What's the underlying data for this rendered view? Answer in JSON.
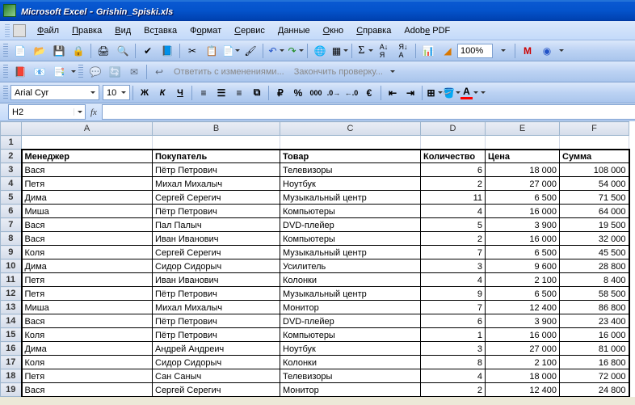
{
  "title_bar": {
    "app": "Microsoft Excel",
    "doc": "Grishin_Spiski.xls"
  },
  "menus": [
    "Файл",
    "Правка",
    "Вид",
    "Вставка",
    "Формат",
    "Сервис",
    "Данные",
    "Окно",
    "Справка",
    "Adobe PDF"
  ],
  "menus_ul": [
    0,
    0,
    0,
    2,
    1,
    0,
    0,
    0,
    0,
    4
  ],
  "toolbar1": {
    "zoom": "100%"
  },
  "review": {
    "reply": "Ответить с изменениями...",
    "end": "Закончить проверку..."
  },
  "format": {
    "font": "Arial Cyr",
    "size": "10",
    "bold": "Ж",
    "italic": "К",
    "underline": "Ч"
  },
  "namebox": "H2",
  "fx": "fx",
  "columns": [
    "A",
    "B",
    "C",
    "D",
    "E",
    "F"
  ],
  "col_widths": [
    "col-A",
    "col-B",
    "col-C",
    "col-D",
    "col-E",
    "col-F"
  ],
  "headers": [
    "Менеджер",
    "Покупатель",
    "Товар",
    "Количество",
    "Цена",
    "Сумма"
  ],
  "rows": [
    {
      "n": 3,
      "c": [
        "Вася",
        "Пётр Петрович",
        "Телевизоры",
        "6",
        "18 000",
        "108 000"
      ]
    },
    {
      "n": 4,
      "c": [
        "Петя",
        "Михал Михалыч",
        "Ноутбук",
        "2",
        "27 000",
        "54 000"
      ]
    },
    {
      "n": 5,
      "c": [
        "Дима",
        "Сергей Серегич",
        "Музыкальный центр",
        "11",
        "6 500",
        "71 500"
      ]
    },
    {
      "n": 6,
      "c": [
        "Миша",
        "Пётр Петрович",
        "Компьютеры",
        "4",
        "16 000",
        "64 000"
      ]
    },
    {
      "n": 7,
      "c": [
        "Вася",
        "Пал Палыч",
        "DVD-плейер",
        "5",
        "3 900",
        "19 500"
      ]
    },
    {
      "n": 8,
      "c": [
        "Вася",
        "Иван Иванович",
        "Компьютеры",
        "2",
        "16 000",
        "32 000"
      ]
    },
    {
      "n": 9,
      "c": [
        "Коля",
        "Сергей Серегич",
        "Музыкальный центр",
        "7",
        "6 500",
        "45 500"
      ]
    },
    {
      "n": 10,
      "c": [
        "Дима",
        "Сидор Сидорыч",
        "Усилитель",
        "3",
        "9 600",
        "28 800"
      ]
    },
    {
      "n": 11,
      "c": [
        "Петя",
        "Иван Иванович",
        "Колонки",
        "4",
        "2 100",
        "8 400"
      ]
    },
    {
      "n": 12,
      "c": [
        "Петя",
        "Пётр Петрович",
        "Музыкальный центр",
        "9",
        "6 500",
        "58 500"
      ]
    },
    {
      "n": 13,
      "c": [
        "Миша",
        "Михал Михалыч",
        "Монитор",
        "7",
        "12 400",
        "86 800"
      ]
    },
    {
      "n": 14,
      "c": [
        "Вася",
        "Пётр Петрович",
        "DVD-плейер",
        "6",
        "3 900",
        "23 400"
      ]
    },
    {
      "n": 15,
      "c": [
        "Коля",
        "Пётр Петрович",
        "Компьютеры",
        "1",
        "16 000",
        "16 000"
      ]
    },
    {
      "n": 16,
      "c": [
        "Дима",
        "Андрей Андреич",
        "Ноутбук",
        "3",
        "27 000",
        "81 000"
      ]
    },
    {
      "n": 17,
      "c": [
        "Коля",
        "Сидор Сидорыч",
        "Колонки",
        "8",
        "2 100",
        "16 800"
      ]
    },
    {
      "n": 18,
      "c": [
        "Петя",
        "Сан Саныч",
        "Телевизоры",
        "4",
        "18 000",
        "72 000"
      ]
    },
    {
      "n": 19,
      "c": [
        "Вася",
        "Сергей Серегич",
        "Монитор",
        "2",
        "12 400",
        "24 800"
      ]
    }
  ],
  "empty_row1": 1,
  "selected_cell": "H2"
}
